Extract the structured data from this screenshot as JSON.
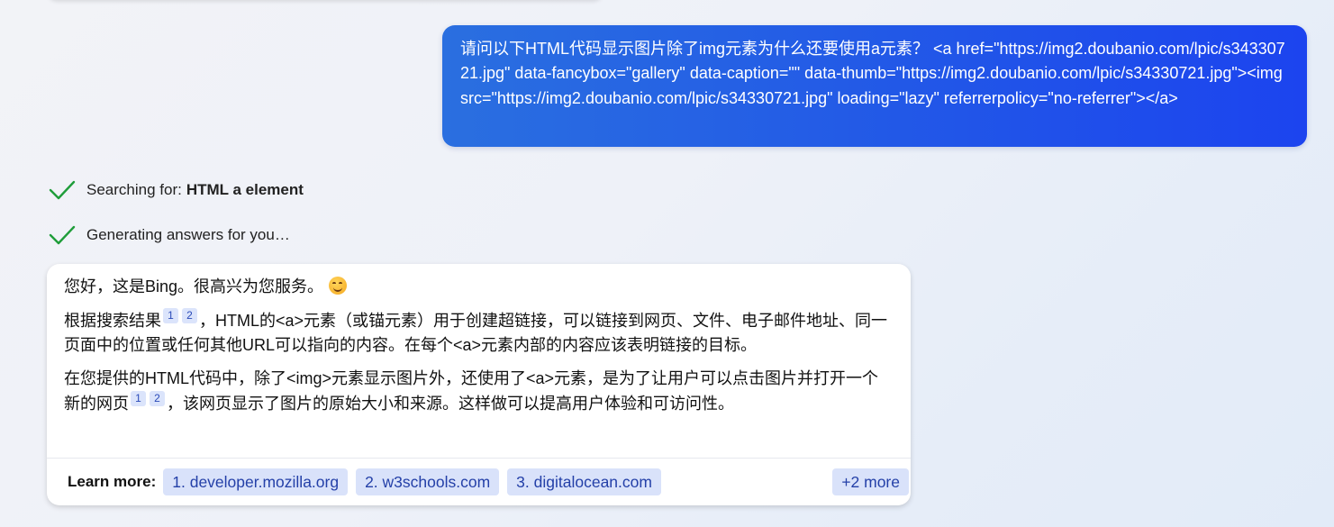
{
  "user_message": {
    "text": "请问以下HTML代码显示图片除了img元素为什么还要使用a元素？ <a href=\"https://img2.doubanio.com/lpic/s34330721.jpg\" data-fancybox=\"gallery\" data-caption=\"\" data-thumb=\"https://img2.doubanio.com/lpic/s34330721.jpg\"><img src=\"https://img2.doubanio.com/lpic/s34330721.jpg\" loading=\"lazy\" referrerpolicy=\"no-referrer\"></a>"
  },
  "status": {
    "searching_prefix": "Searching for:",
    "searching_query": "HTML a element",
    "generating": "Generating answers for you…"
  },
  "answer": {
    "greeting": "您好，这是Bing。很高兴为您服务。",
    "emoji_icon": "smiling-face-icon",
    "p1_part1": "根据搜索结果",
    "p1_part2": "，HTML的<a>元素（或锚元素）用于创建超链接，可以链接到网页、文件、电子邮件地址、同一页面中的位置或任何其他URL可以指向的内容。在每个<a>元素内部的内容应该表明链接的目标。",
    "p2_part1": "在您提供的HTML代码中，除了<img>元素显示图片外，还使用了<a>元素，是为了让用户可以点击图片并打开一个新的网页",
    "p2_part2": "，该网页显示了图片的原始大小和来源。这样做可以提高用户体验和可访问性。",
    "citations": [
      "1",
      "2"
    ]
  },
  "learn_more": {
    "label": "Learn more:",
    "links": [
      "1. developer.mozilla.org",
      "2. w3schools.com",
      "3. digitalocean.com"
    ],
    "more": "+2 more"
  },
  "colors": {
    "user_bubble_start": "#2a6fe0",
    "user_bubble_end": "#1c44ef",
    "check_green": "#1f9d3a",
    "chip_bg": "#d9e2fa",
    "chip_text": "#2440a8"
  }
}
